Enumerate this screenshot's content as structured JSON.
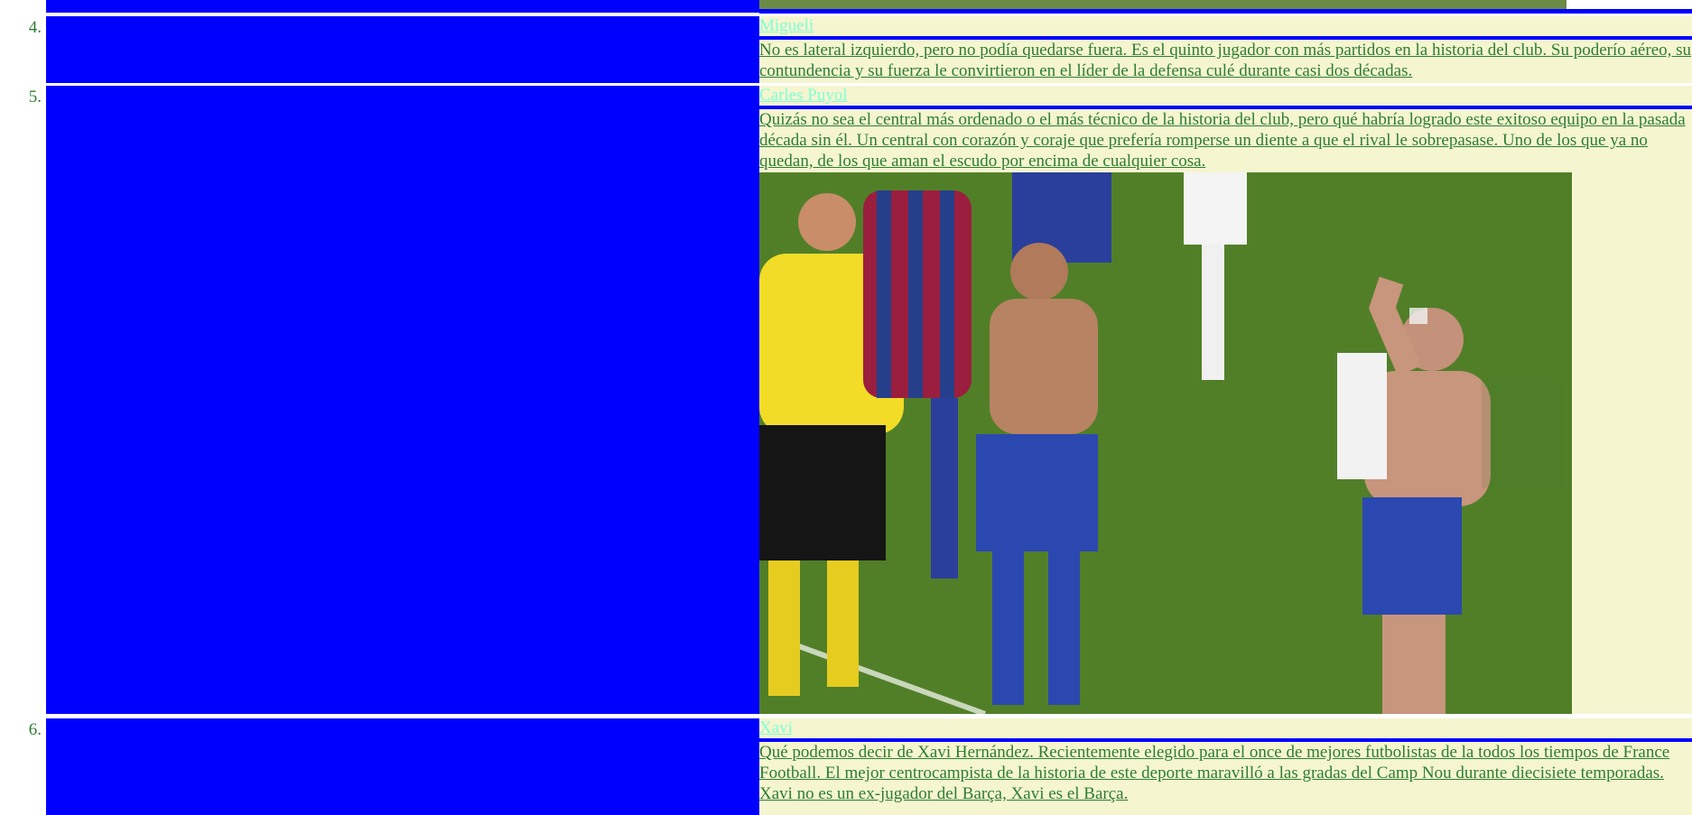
{
  "items": [
    {
      "number": "4.",
      "title": "Migueli",
      "description": "No es lateral izquierdo, pero no podía quedarse fuera. Es el quinto jugador con más partidos en la historia del club. Su poderío aéreo, su contundencia y su fuerza le convirtieron en el líder de la defensa culé durante casi dos décadas."
    },
    {
      "number": "5.",
      "title": "Carles Puyol",
      "description": "Quizás no sea el central más ordenado o el más técnico de la historia del club, pero qué habría logrado este exitoso equipo en la pasada década sin él. Un central con corazón y coraje que prefería romperse un diente a que el rival le sobrepasase. Uno de los que ya no quedan, de los que aman el escudo por encima de cualquier cosa."
    },
    {
      "number": "6.",
      "title": "Xavi",
      "description": "Qué podemos decir de Xavi Hernández. Recientemente elegido para el once de mejores futbolistas de la todos los tiempos de France Football. El mejor centrocampista de la historia de este deporte maravilló a las gradas del Camp Nou durante diecisiete temporadas. Xavi no es un ex-jugador del Barça, Xavi es el Barça."
    }
  ],
  "colors": {
    "blue": "#0000ff",
    "cream": "#f5f5d0",
    "text_green": "#2e7d32",
    "title_aqua": "#7fffd4",
    "grass": "#4f7a27"
  }
}
